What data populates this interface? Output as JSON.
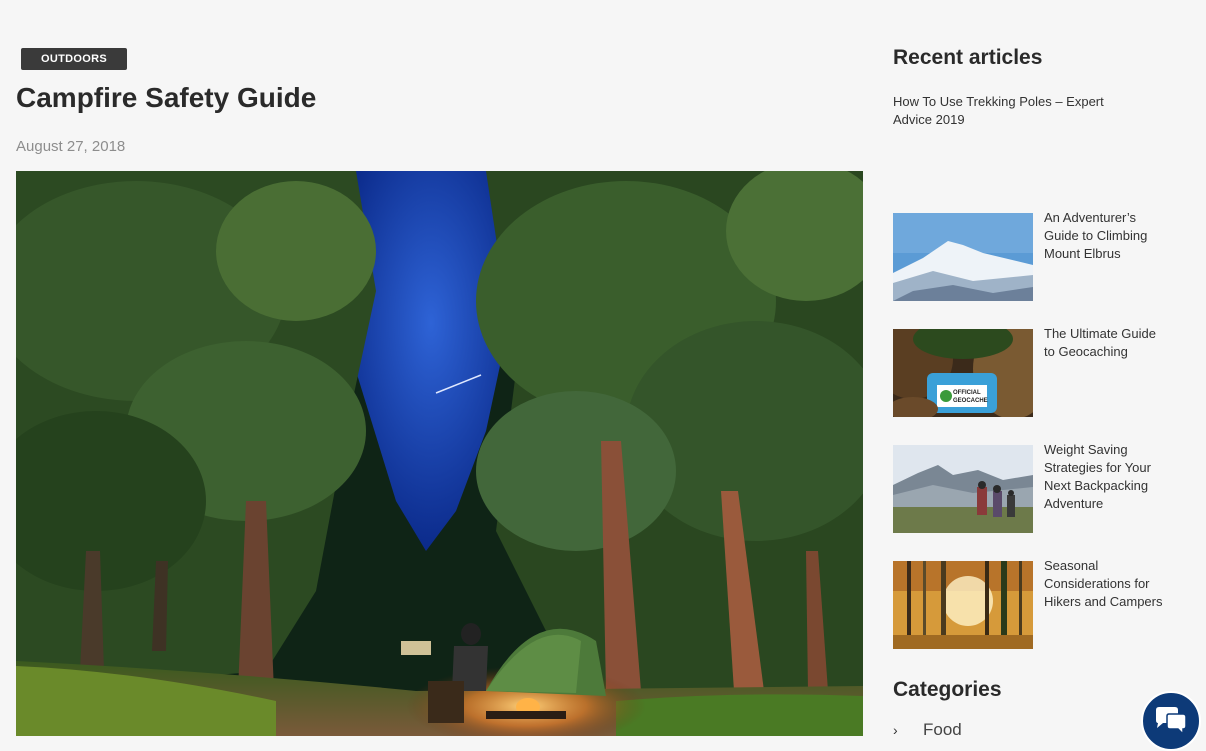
{
  "post": {
    "category": "OUTDOORS",
    "title": "Campfire Safety Guide",
    "date": "August 27, 2018"
  },
  "sidebar": {
    "recent_heading": "Recent articles",
    "first_article": "How To Use Trekking Poles – Expert Advice 2019",
    "articles": [
      {
        "title": "An Adventurer’s Guide to Climbing Mount Elbrus",
        "thumb": "mountain-snow"
      },
      {
        "title": "The Ultimate Guide to Geocaching",
        "thumb": "geocache-box"
      },
      {
        "title": "Weight Saving Strategies for Your Next Backpacking Adventure",
        "thumb": "hikers-mountains"
      },
      {
        "title": "Seasonal Considerations for Hikers and Campers",
        "thumb": "autumn-forest"
      }
    ],
    "categories_heading": "Categories",
    "categories": [
      {
        "label": "Food"
      }
    ]
  },
  "thumb_text": {
    "geocache_line1": "OFFICIAL",
    "geocache_line2": "GEOCACHE"
  },
  "icons": {
    "chat": "chat-bubbles-icon",
    "chevron": "chevron-right-icon"
  },
  "colors": {
    "badge_bg": "#3a3a3a",
    "chat_bg": "#0d3a78",
    "page_bg": "#f6f6f6"
  }
}
